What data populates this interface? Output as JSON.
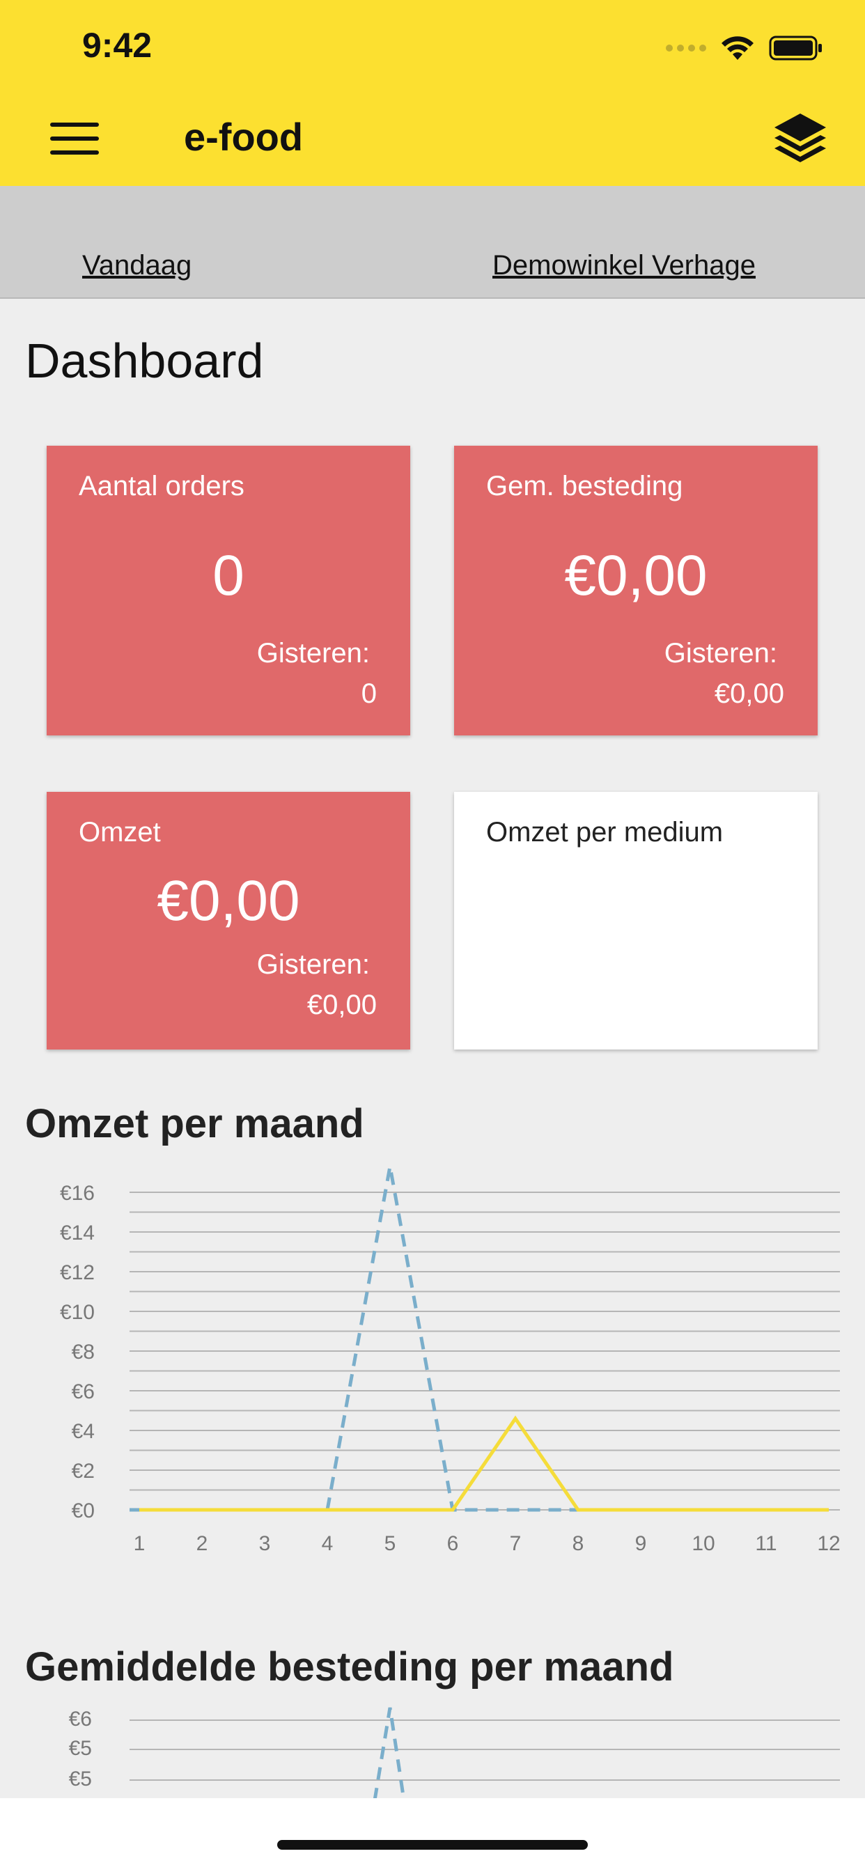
{
  "status": {
    "time": "9:42"
  },
  "app": {
    "title": "e-food"
  },
  "subbar": {
    "date_link": "Vandaag",
    "store_link": "Demowinkel Verhage"
  },
  "page": {
    "title": "Dashboard"
  },
  "cards": {
    "orders": {
      "label": "Aantal orders",
      "value": "0",
      "prev_label": "Gisteren:",
      "prev_value": "0"
    },
    "avg": {
      "label": "Gem. besteding",
      "value": "€0,00",
      "prev_label": "Gisteren:",
      "prev_value": "€0,00"
    },
    "revenue": {
      "label": "Omzet",
      "value": "€0,00",
      "prev_label": "Gisteren:",
      "prev_value": "€0,00"
    },
    "medium": {
      "label": "Omzet per medium"
    }
  },
  "colors": {
    "accent": "#fce030",
    "card_red": "#e0696a",
    "series_current": "#f5dc3a",
    "series_previous": "#7aaecb"
  },
  "chart_data": [
    {
      "type": "line",
      "title": "Omzet per maand",
      "x": [
        1,
        2,
        3,
        4,
        5,
        6,
        7,
        8,
        9,
        10,
        11,
        12
      ],
      "y_ticks": [
        "€0",
        "€2",
        "€4",
        "€6",
        "€8",
        "€10",
        "€12",
        "€14",
        "€16"
      ],
      "ylim": [
        0,
        16
      ],
      "grid": true,
      "series": [
        {
          "style": "dashed",
          "color": "#7aaecb",
          "values": [
            0,
            0,
            0,
            0,
            17.3,
            0,
            0,
            0,
            0,
            0,
            0,
            0
          ]
        },
        {
          "style": "solid",
          "color": "#f5dc3a",
          "values": [
            0,
            0,
            0,
            0,
            0,
            0,
            4.6,
            0,
            0,
            0,
            0,
            0
          ]
        }
      ]
    },
    {
      "type": "line",
      "title": "Gemiddelde besteding per maand",
      "y_ticks": [
        "€5",
        "€5",
        "€6"
      ],
      "grid": true,
      "series": [
        {
          "style": "dashed",
          "color": "#7aaecb",
          "values": [
            0,
            0,
            0,
            0,
            5.8,
            0,
            0,
            0,
            0,
            0,
            0,
            0
          ]
        }
      ]
    }
  ]
}
